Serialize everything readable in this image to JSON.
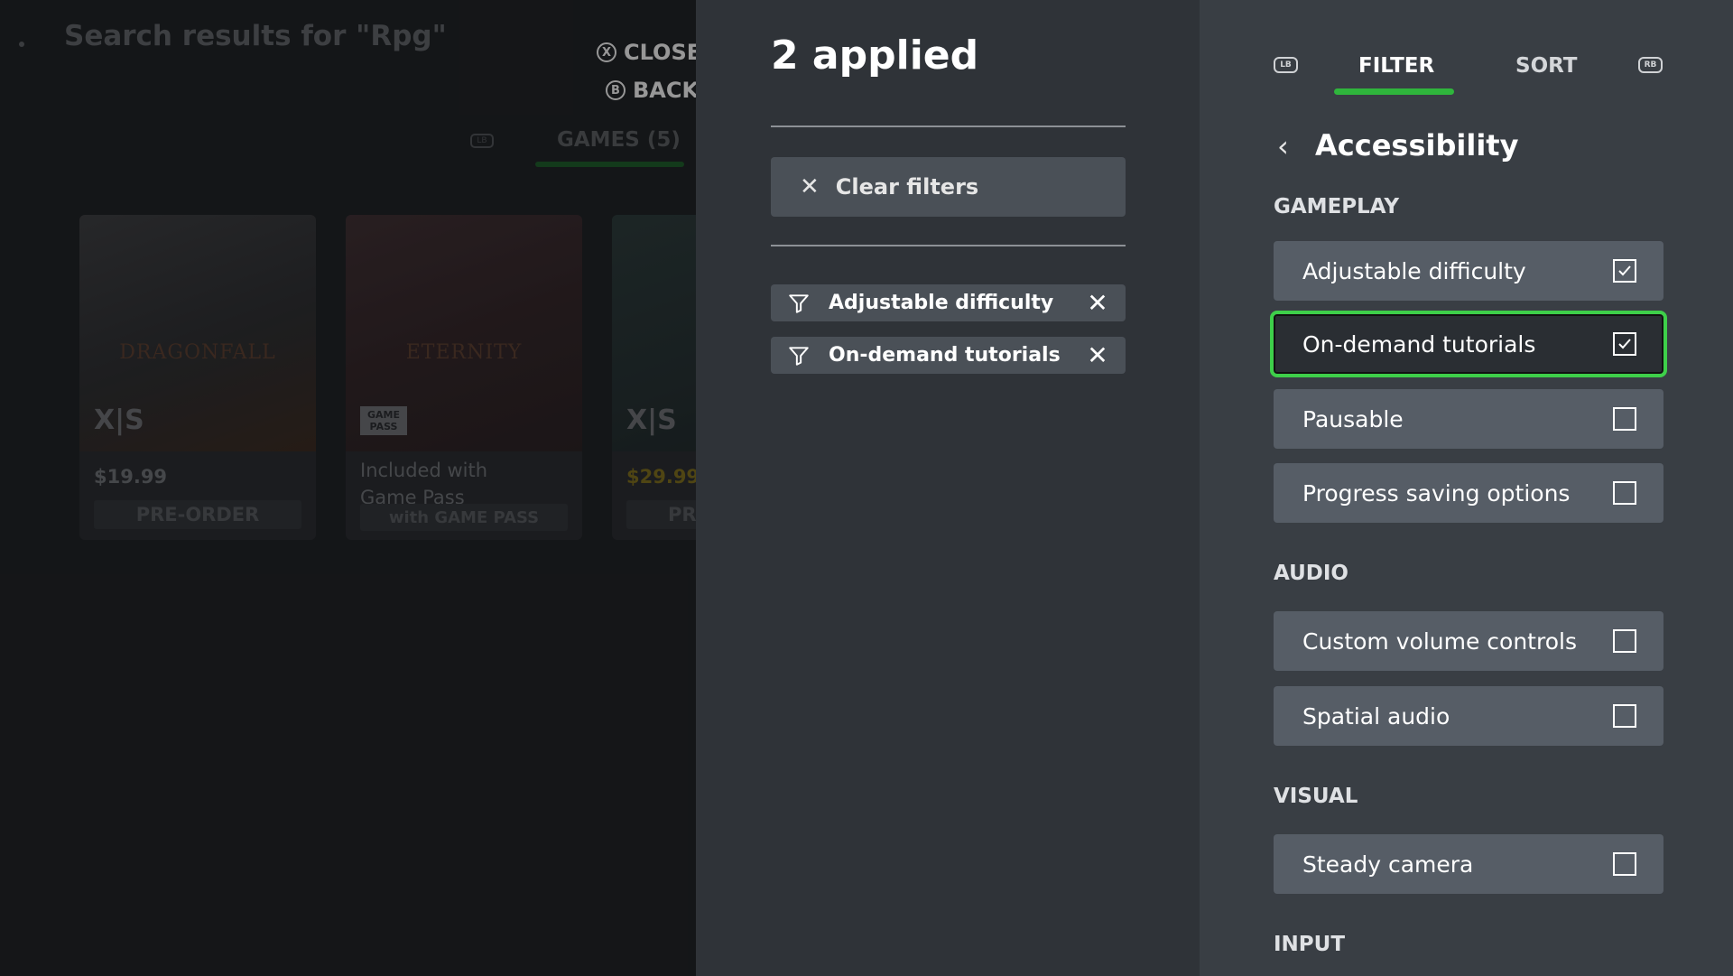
{
  "background": {
    "search_title": "Search results for \"Rpg\"",
    "hint_close": {
      "glyph": "X",
      "label": "CLOSE"
    },
    "hint_back": {
      "glyph": "B",
      "label": "BACK"
    },
    "lb_icon": "LB",
    "games_tab": "GAMES (5)",
    "cards": [
      {
        "art_title": "DRAGONFALL",
        "platform": "X|S",
        "price": "$19.99",
        "action": "PRE-ORDER"
      },
      {
        "art_title": "ETERNITY",
        "badge": "GAME PASS",
        "gp_text_line1": "Included with",
        "gp_text_line2": "Game Pass",
        "action": "with GAME PASS"
      },
      {
        "platform": "X|S",
        "price": "$29.99",
        "action": "PR"
      }
    ]
  },
  "applied_panel": {
    "title": "2 applied",
    "clear_label": "Clear filters",
    "chips": [
      {
        "label": "Adjustable difficulty"
      },
      {
        "label": "On-demand tutorials"
      }
    ]
  },
  "filter_panel": {
    "lb": "LB",
    "rb": "RB",
    "tabs": {
      "filter": "FILTER",
      "sort": "SORT"
    },
    "heading": "Accessibility",
    "groups": {
      "gameplay": "GAMEPLAY",
      "audio": "AUDIO",
      "visual": "VISUAL",
      "input": "INPUT"
    },
    "options": [
      {
        "label": "Adjustable difficulty",
        "checked": true
      },
      {
        "label": "On-demand tutorials",
        "checked": true,
        "focused": true
      },
      {
        "label": "Pausable",
        "checked": false
      },
      {
        "label": "Progress saving options",
        "checked": false
      },
      {
        "label": "Custom volume controls",
        "checked": false
      },
      {
        "label": "Spatial audio",
        "checked": false
      },
      {
        "label": "Steady camera",
        "checked": false
      }
    ],
    "colors": {
      "accent": "#2fb53c",
      "focus_outline": "#3ecf4a"
    }
  }
}
